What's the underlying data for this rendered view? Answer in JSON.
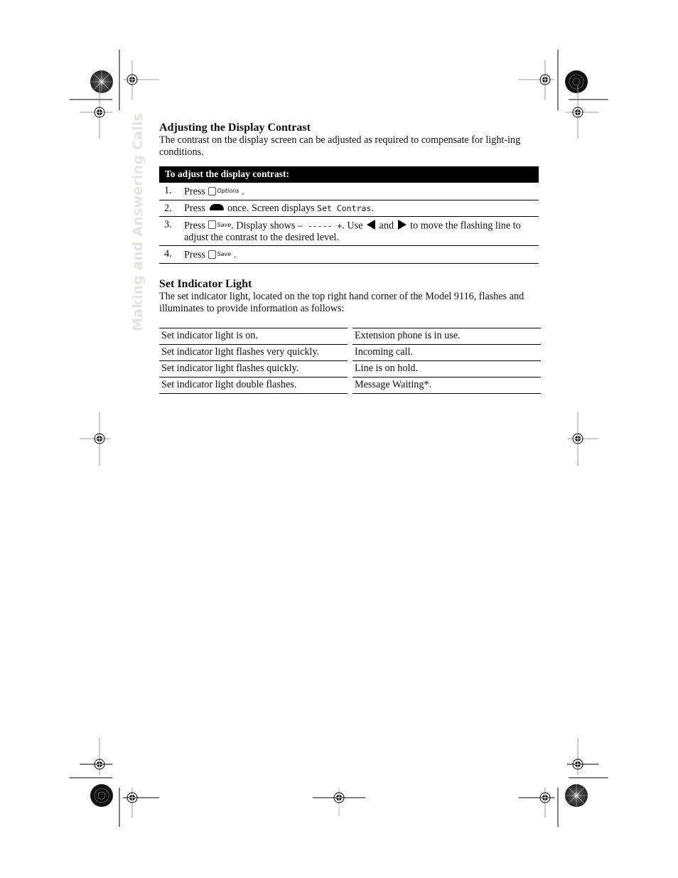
{
  "side_tab": "Making and Answering Calls",
  "section1": {
    "title": "Adjusting the Display Contrast",
    "intro": "The contrast on the display screen can be adjusted as required to compensate for light-ing conditions.",
    "procedure": {
      "header": "To adjust the display contrast:",
      "steps": [
        {
          "num": "1.",
          "pre": "Press",
          "key_label": "Options",
          "post": "."
        },
        {
          "num": "2.",
          "pre": "Press",
          "icon": "up-dome-key-icon",
          "mid": "once. Screen displays",
          "lcd": "Set Contras",
          "post": "."
        },
        {
          "num": "3.",
          "pre": "Press",
          "key_label": "Save",
          "mid": ". Display shows",
          "lcd": "– ----- +",
          "mid2": ". Use",
          "and": "and",
          "post": "to move the flashing line to adjust the contrast to the desired level."
        },
        {
          "num": "4.",
          "pre": "Press",
          "key_label": "Save",
          "post": "."
        }
      ]
    }
  },
  "section2": {
    "title": "Set Indicator Light",
    "intro": "The set indicator light, located on the top right hand corner of the Model 9116, flashes and illuminates to provide information as follows:",
    "rows": [
      {
        "state": "Set indicator light is on.",
        "meaning": "Extension phone is in use."
      },
      {
        "state": "Set indicator light flashes very quickly.",
        "meaning": "Incoming call."
      },
      {
        "state": "Set indicator light flashes quickly.",
        "meaning": "Line is on hold."
      },
      {
        "state": "Set indicator light double flashes.",
        "meaning": "Message Waiting*."
      }
    ]
  }
}
